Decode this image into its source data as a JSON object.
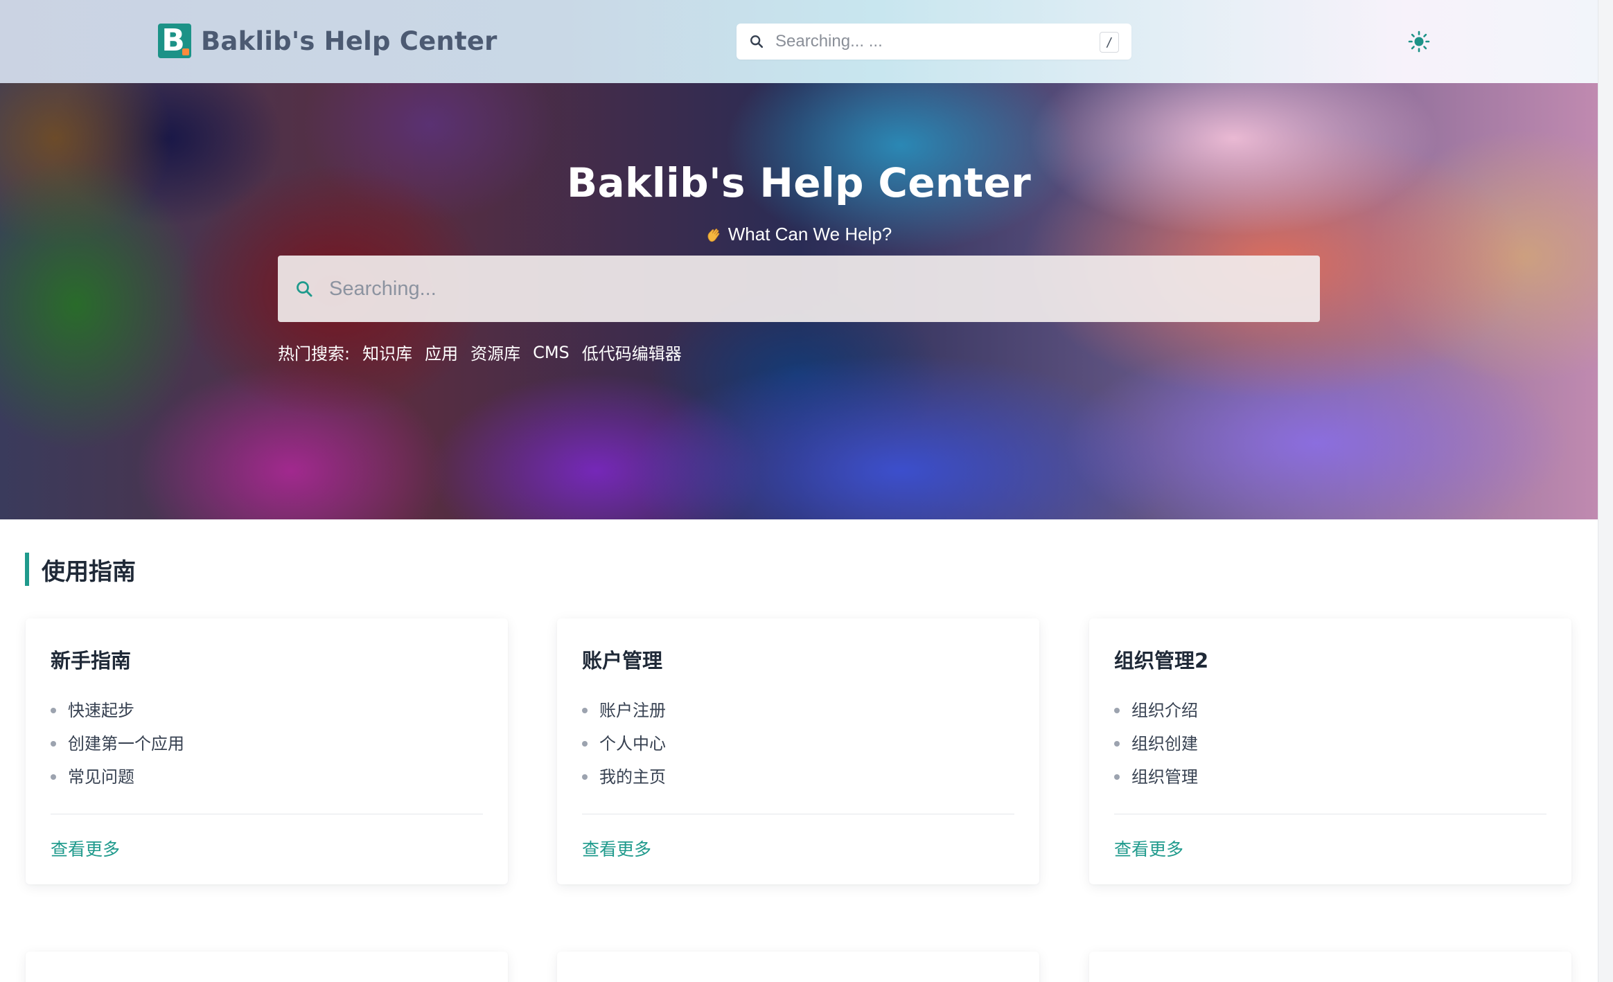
{
  "header": {
    "logo_letter": "B",
    "brand_name": "Baklib's Help Center",
    "search_placeholder": "Searching... ...",
    "search_shortcut": "/",
    "theme_icon": "sun-icon"
  },
  "hero": {
    "title": "Baklib's Help Center",
    "subtitle_icon": "waving-hand-icon",
    "subtitle": "What Can We Help?",
    "search_placeholder": "Searching...",
    "hot_label": "热门搜索:",
    "hot_tags": [
      "知识库",
      "应用",
      "资源库",
      "CMS",
      "低代码编辑器"
    ]
  },
  "section": {
    "title": "使用指南",
    "accent_color": "#1f9a8c"
  },
  "cards": [
    {
      "title": "新手指南",
      "items": [
        "快速起步",
        "创建第一个应用",
        "常见问题"
      ],
      "more": "查看更多"
    },
    {
      "title": "账户管理",
      "items": [
        "账户注册",
        "个人中心",
        "我的主页"
      ],
      "more": "查看更多"
    },
    {
      "title": "组织管理2",
      "items": [
        "组织介绍",
        "组织创建",
        "组织管理"
      ],
      "more": "查看更多"
    }
  ],
  "colors": {
    "brand": "#1c9287",
    "link": "#1f9a8c",
    "logo_dot": "#ff8a3d"
  }
}
